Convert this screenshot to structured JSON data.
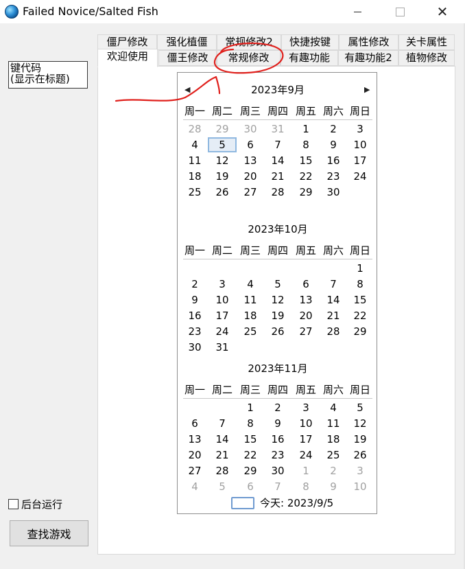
{
  "window": {
    "title": "Failed Novice/Salted Fish"
  },
  "left": {
    "hotkey_label": "键代码\n(显示在标题)",
    "background_run_label": "后台运行",
    "find_game_label": "查找游戏"
  },
  "tabs": {
    "row1": [
      "僵尸修改",
      "强化植僵",
      "常规修改2",
      "快捷按键",
      "属性修改",
      "关卡属性"
    ],
    "row2": [
      "欢迎使用",
      "僵王修改",
      "常规修改",
      "有趣功能",
      "有趣功能2",
      "植物修改"
    ]
  },
  "calendar": {
    "weekdays": [
      "周一",
      "周二",
      "周三",
      "周四",
      "周五",
      "周六",
      "周日"
    ],
    "months": [
      {
        "title": "2023年9月",
        "weeks": [
          [
            {
              "d": "28",
              "o": true
            },
            {
              "d": "29",
              "o": true
            },
            {
              "d": "30",
              "o": true
            },
            {
              "d": "31",
              "o": true
            },
            {
              "d": "1"
            },
            {
              "d": "2"
            },
            {
              "d": "3"
            }
          ],
          [
            {
              "d": "4"
            },
            {
              "d": "5",
              "sel": true
            },
            {
              "d": "6"
            },
            {
              "d": "7"
            },
            {
              "d": "8"
            },
            {
              "d": "9"
            },
            {
              "d": "10"
            }
          ],
          [
            {
              "d": "11"
            },
            {
              "d": "12"
            },
            {
              "d": "13"
            },
            {
              "d": "14"
            },
            {
              "d": "15"
            },
            {
              "d": "16"
            },
            {
              "d": "17"
            }
          ],
          [
            {
              "d": "18"
            },
            {
              "d": "19"
            },
            {
              "d": "20"
            },
            {
              "d": "21"
            },
            {
              "d": "22"
            },
            {
              "d": "23"
            },
            {
              "d": "24"
            }
          ],
          [
            {
              "d": "25"
            },
            {
              "d": "26"
            },
            {
              "d": "27"
            },
            {
              "d": "28"
            },
            {
              "d": "29"
            },
            {
              "d": "30"
            },
            {
              "d": ""
            }
          ]
        ]
      },
      {
        "title": "2023年10月",
        "weeks": [
          [
            {
              "d": ""
            },
            {
              "d": ""
            },
            {
              "d": ""
            },
            {
              "d": ""
            },
            {
              "d": ""
            },
            {
              "d": ""
            },
            {
              "d": "1"
            }
          ],
          [
            {
              "d": "2"
            },
            {
              "d": "3"
            },
            {
              "d": "4"
            },
            {
              "d": "5"
            },
            {
              "d": "6"
            },
            {
              "d": "7"
            },
            {
              "d": "8"
            }
          ],
          [
            {
              "d": "9"
            },
            {
              "d": "10"
            },
            {
              "d": "11"
            },
            {
              "d": "12"
            },
            {
              "d": "13"
            },
            {
              "d": "14"
            },
            {
              "d": "15"
            }
          ],
          [
            {
              "d": "16"
            },
            {
              "d": "17"
            },
            {
              "d": "18"
            },
            {
              "d": "19"
            },
            {
              "d": "20"
            },
            {
              "d": "21"
            },
            {
              "d": "22"
            }
          ],
          [
            {
              "d": "23"
            },
            {
              "d": "24"
            },
            {
              "d": "25"
            },
            {
              "d": "26"
            },
            {
              "d": "27"
            },
            {
              "d": "28"
            },
            {
              "d": "29"
            }
          ],
          [
            {
              "d": "30"
            },
            {
              "d": "31"
            },
            {
              "d": ""
            },
            {
              "d": ""
            },
            {
              "d": ""
            },
            {
              "d": ""
            },
            {
              "d": ""
            }
          ]
        ]
      },
      {
        "title": "2023年11月",
        "weeks": [
          [
            {
              "d": ""
            },
            {
              "d": ""
            },
            {
              "d": "1"
            },
            {
              "d": "2"
            },
            {
              "d": "3"
            },
            {
              "d": "4"
            },
            {
              "d": "5"
            }
          ],
          [
            {
              "d": "6"
            },
            {
              "d": "7"
            },
            {
              "d": "8"
            },
            {
              "d": "9"
            },
            {
              "d": "10"
            },
            {
              "d": "11"
            },
            {
              "d": "12"
            }
          ],
          [
            {
              "d": "13"
            },
            {
              "d": "14"
            },
            {
              "d": "15"
            },
            {
              "d": "16"
            },
            {
              "d": "17"
            },
            {
              "d": "18"
            },
            {
              "d": "19"
            }
          ],
          [
            {
              "d": "20"
            },
            {
              "d": "21"
            },
            {
              "d": "22"
            },
            {
              "d": "23"
            },
            {
              "d": "24"
            },
            {
              "d": "25"
            },
            {
              "d": "26"
            }
          ],
          [
            {
              "d": "27"
            },
            {
              "d": "28"
            },
            {
              "d": "29"
            },
            {
              "d": "30"
            },
            {
              "d": "1",
              "o": true
            },
            {
              "d": "2",
              "o": true
            },
            {
              "d": "3",
              "o": true
            }
          ],
          [
            {
              "d": "4",
              "o": true
            },
            {
              "d": "5",
              "o": true
            },
            {
              "d": "6",
              "o": true
            },
            {
              "d": "7",
              "o": true
            },
            {
              "d": "8",
              "o": true
            },
            {
              "d": "9",
              "o": true
            },
            {
              "d": "10",
              "o": true
            }
          ]
        ]
      }
    ],
    "today_label": "今天: 2023/9/5"
  },
  "colors": {
    "annotation": "#e0201c",
    "tab_border": "#d9d9d9"
  }
}
